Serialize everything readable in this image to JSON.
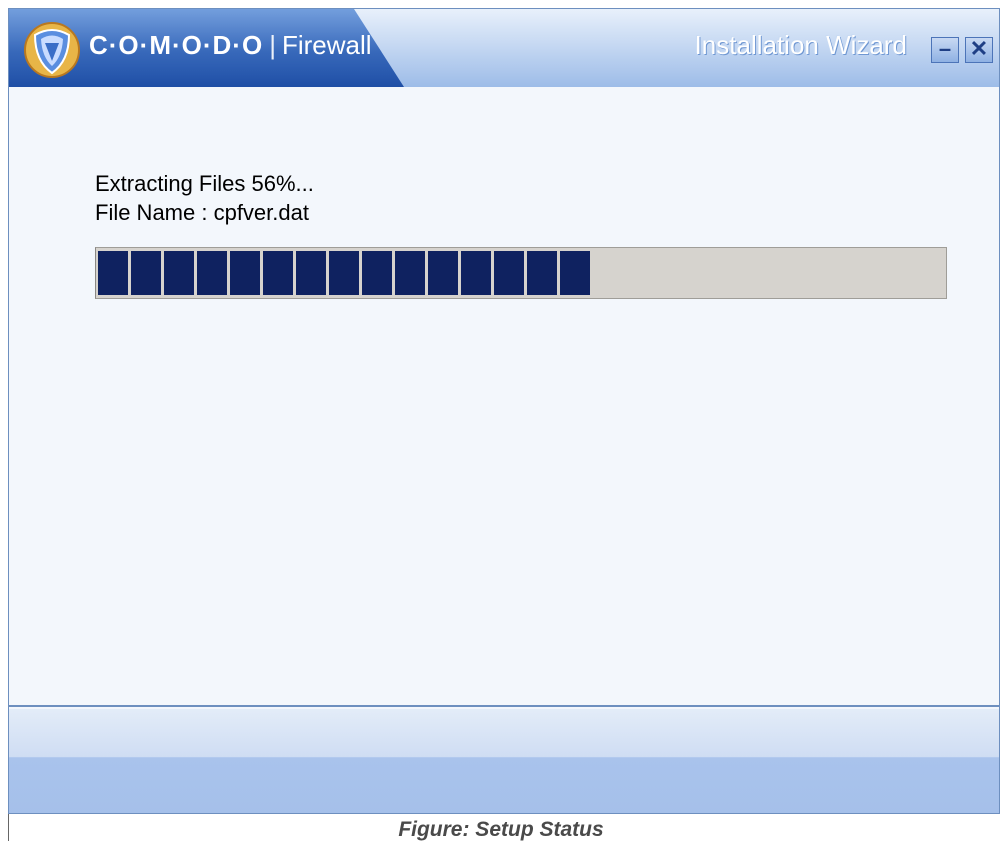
{
  "window": {
    "brand_name": "C·O·M·O·D·O",
    "brand_separator": "|",
    "product_name": "Firewall",
    "title": "Installation Wizard",
    "minimize_label": "–",
    "close_label": "✕",
    "logo_icon": "comodo-shield-icon",
    "accent_color": "#2b5fb6"
  },
  "status": {
    "message": "Extracting Files 56%...",
    "file_name_line": "File Name : cpfver.dat"
  },
  "progress": {
    "percent": 56,
    "segments_filled": 15,
    "fill_color": "#0f2260",
    "track_color": "#d6d3ce"
  },
  "caption": "Figure: Setup Status"
}
